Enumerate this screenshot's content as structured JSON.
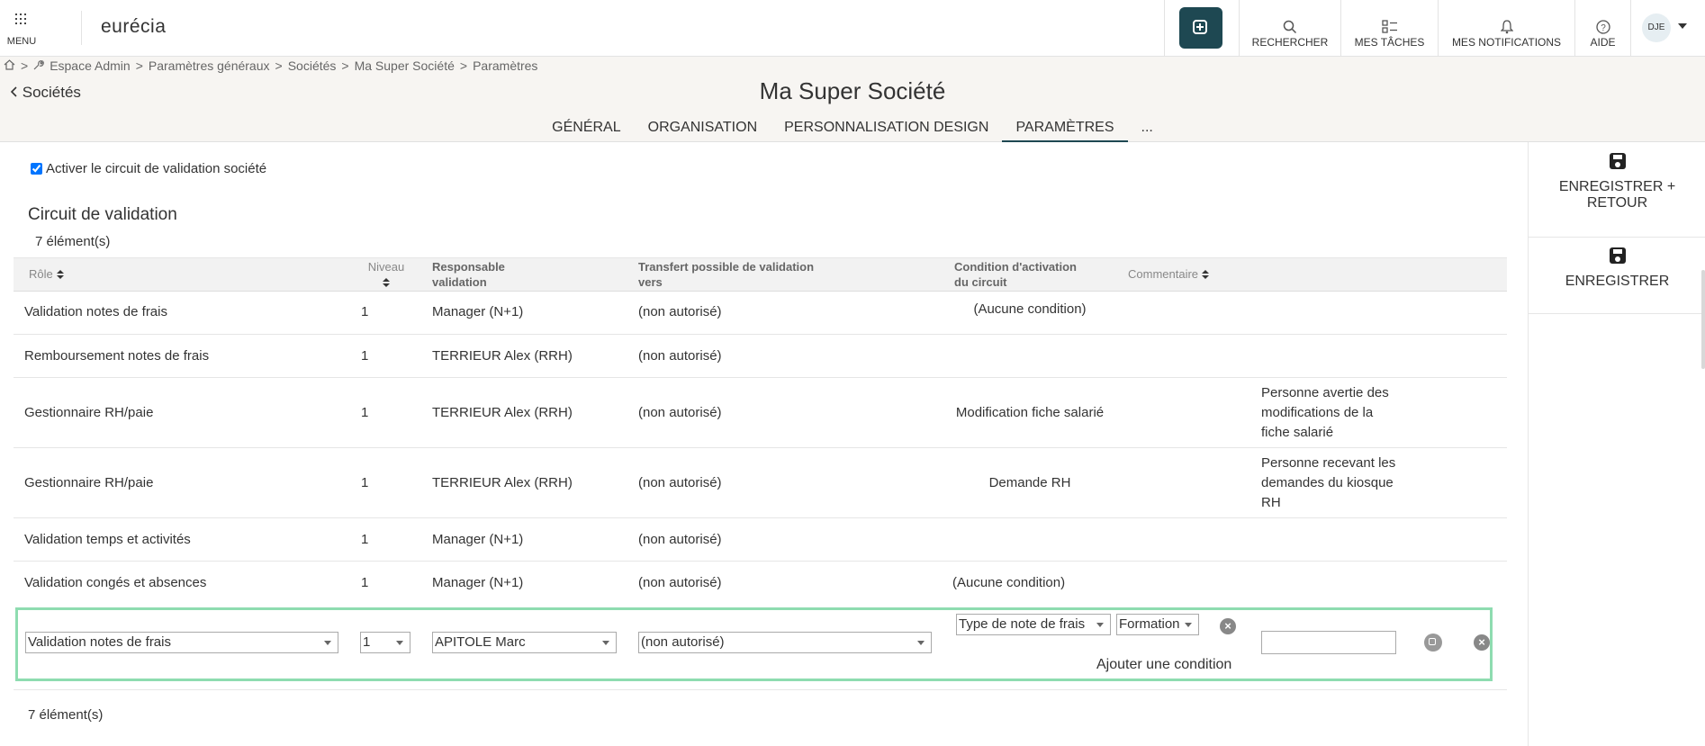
{
  "topbar": {
    "menu_label": "MENU",
    "logo_text": "eurécia",
    "actions": [
      {
        "icon": "search-icon",
        "label": "RECHERCHER"
      },
      {
        "icon": "tasks-icon",
        "label": "MES TÂCHES"
      },
      {
        "icon": "bell-icon",
        "label": "MES NOTIFICATIONS"
      },
      {
        "icon": "help-icon",
        "label": "AIDE"
      }
    ],
    "avatar_initials": "DJE",
    "accent_color": "#1e4852"
  },
  "breadcrumb": {
    "items": [
      "Espace Admin",
      "Paramètres généraux",
      "Sociétés",
      "Ma Super Société",
      "Paramètres"
    ]
  },
  "header": {
    "back_label": "Sociétés",
    "title": "Ma Super Société",
    "tabs": [
      {
        "label": "GÉNÉRAL",
        "active": false
      },
      {
        "label": "ORGANISATION",
        "active": false
      },
      {
        "label": "PERSONNALISATION DESIGN",
        "active": false
      },
      {
        "label": "PARAMÈTRES",
        "active": true
      },
      {
        "label": "...",
        "active": false
      }
    ]
  },
  "main": {
    "checkbox_label": "Activer le circuit de validation société",
    "checkbox_checked": true,
    "section_title": "Circuit de validation",
    "count_label": "7 élément(s)",
    "columns": {
      "role": "Rôle",
      "niveau": "Niveau",
      "responsable_1": "Responsable",
      "responsable_2": "validation",
      "transfert_1": "Transfert possible de validation",
      "transfert_2": "vers",
      "condition_1": "Condition d'activation",
      "condition_2": "du circuit",
      "commentaire": "Commentaire"
    },
    "rows": [
      {
        "role": "Validation notes de frais",
        "niveau": "1",
        "responsable": "Manager (N+1)",
        "transfert": "(non autorisé)",
        "condition": "(Aucune condition)",
        "commentaire": ""
      },
      {
        "role": "Remboursement notes de frais",
        "niveau": "1",
        "responsable": "TERRIEUR Alex (RRH)",
        "transfert": "(non autorisé)",
        "condition": "",
        "commentaire": ""
      },
      {
        "role": "Gestionnaire RH/paie",
        "niveau": "1",
        "responsable": "TERRIEUR Alex (RRH)",
        "transfert": "(non autorisé)",
        "condition": "Modification fiche salarié",
        "commentaire": "Personne avertie des modifications de la fiche salarié"
      },
      {
        "role": "Gestionnaire RH/paie",
        "niveau": "1",
        "responsable": "TERRIEUR Alex (RRH)",
        "transfert": "(non autorisé)",
        "condition": "Demande RH",
        "commentaire": "Personne recevant les demandes du kiosque RH"
      },
      {
        "role": "Validation temps et activités",
        "niveau": "1",
        "responsable": "Manager (N+1)",
        "transfert": "(non autorisé)",
        "condition": "",
        "commentaire": ""
      },
      {
        "role": "Validation congés et absences",
        "niveau": "1",
        "responsable": "Manager (N+1)",
        "transfert": "(non autorisé)",
        "condition": "(Aucune condition)",
        "commentaire": ""
      }
    ],
    "edit_row": {
      "role": "Validation notes de frais",
      "niveau": "1",
      "responsable": "APITOLE Marc",
      "transfert": "(non autorisé)",
      "condition_type": "Type de note de frais",
      "condition_value": "Formation",
      "add_condition_label": "Ajouter une condition",
      "commentaire": ""
    },
    "footer_count": "7 élément(s)",
    "highlight_color": "#8edcb0"
  },
  "sidebar": {
    "save_return_1": "ENREGISTRER +",
    "save_return_2": "RETOUR",
    "save": "ENREGISTRER"
  }
}
